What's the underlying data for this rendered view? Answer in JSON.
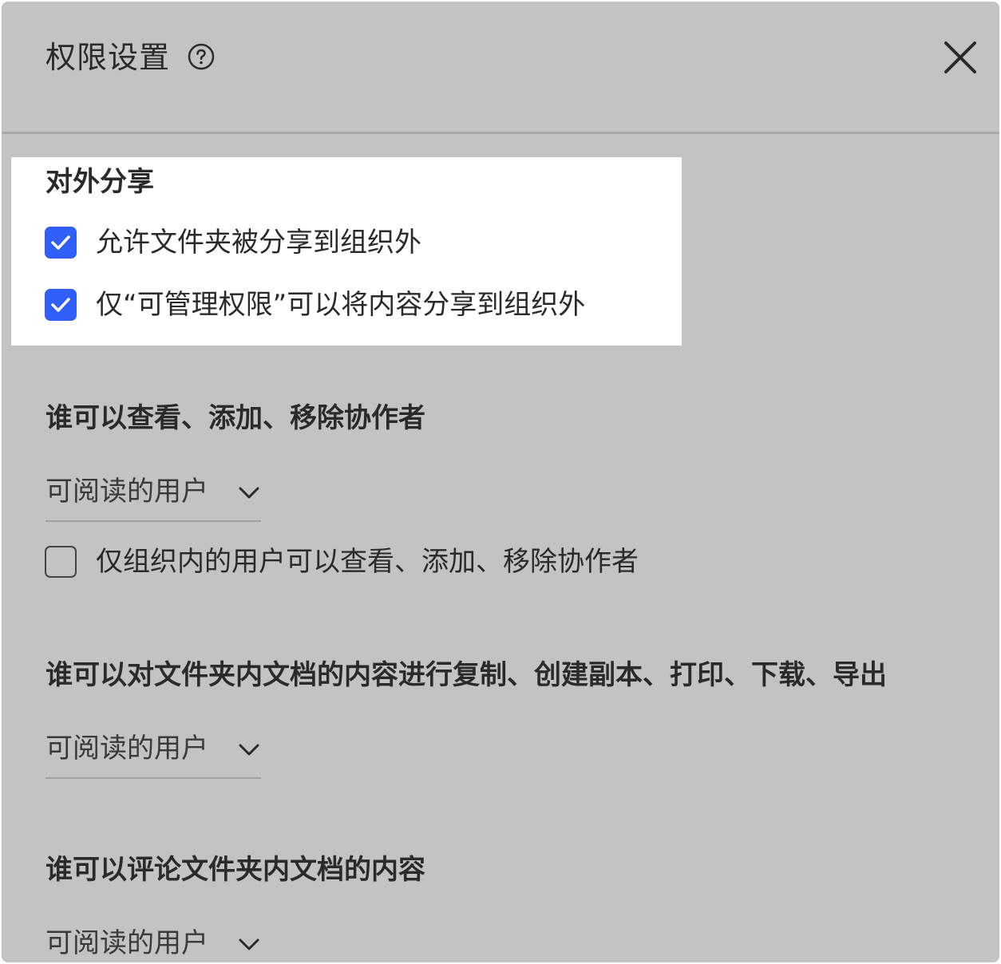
{
  "header": {
    "title": "权限设置",
    "help_icon": "question-circle-icon",
    "close_icon": "close-icon"
  },
  "external_share": {
    "title": "对外分享",
    "options": [
      {
        "label": "允许文件夹被分享到组织外",
        "checked": true
      },
      {
        "label": "仅“可管理权限”可以将内容分享到组织外",
        "checked": true
      }
    ]
  },
  "collaborators": {
    "title": "谁可以查看、添加、移除协作者",
    "select_value": "可阅读的用户",
    "option": {
      "label": "仅组织内的用户可以查看、添加、移除协作者",
      "checked": false
    }
  },
  "copy_permission": {
    "title": "谁可以对文件夹内文档的内容进行复制、创建副本、打印、下载、导出",
    "select_value": "可阅读的用户"
  },
  "comment_permission": {
    "title": "谁可以评论文件夹内文档的内容",
    "select_value": "可阅读的用户"
  },
  "colors": {
    "panel_bg": "#c3c3c3",
    "highlight_bg": "#ffffff",
    "checkbox_accent": "#2f5ff6",
    "text": "#2a2a2a"
  }
}
